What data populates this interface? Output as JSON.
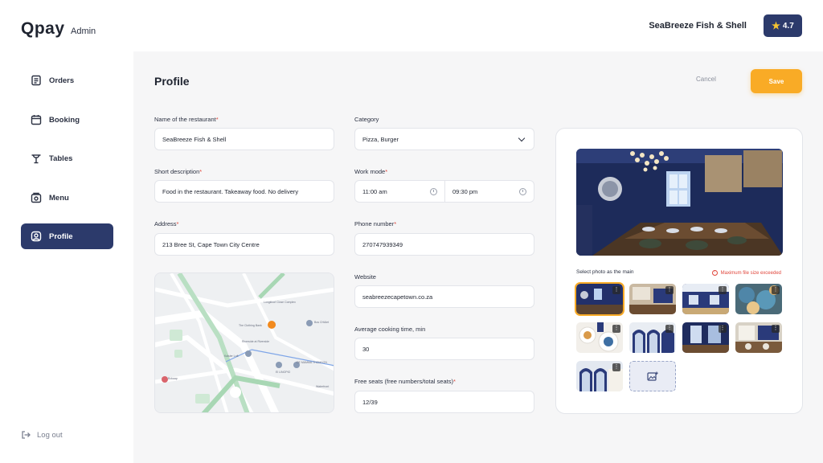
{
  "header": {
    "logo": "Qpay",
    "logo_sub": "Admin",
    "restaurant_name": "SeaBreeze Fish & Shell",
    "rating": "4.7",
    "rating_icon": "star-icon"
  },
  "sidebar": {
    "items": [
      {
        "label": "Orders",
        "icon": "orders-icon",
        "active": false
      },
      {
        "label": "Booking",
        "icon": "calendar-icon",
        "active": false
      },
      {
        "label": "Tables",
        "icon": "table-icon",
        "active": false
      },
      {
        "label": "Menu",
        "icon": "menu-icon",
        "active": false
      },
      {
        "label": "Profile",
        "icon": "user-icon",
        "active": true
      }
    ],
    "logout_label": "Log out"
  },
  "page": {
    "title": "Profile",
    "cancel_label": "Cancel",
    "save_label": "Save"
  },
  "form": {
    "name": {
      "label": "Name of the restaurant",
      "value": "SeaBreeze Fish & Shell"
    },
    "short_description": {
      "label": "Short description",
      "value": "Food in the restaurant. Takeaway food. No delivery"
    },
    "address": {
      "label": "Address",
      "value": "213 Bree St, Cape Town City Centre"
    },
    "category": {
      "label": "Category",
      "value": "Pizza, Burger"
    },
    "work_mode": {
      "label": "Work mode",
      "from": "11:00 am",
      "to": "09:30 pm"
    },
    "phone": {
      "label": "Phone number",
      "value": "270747939349"
    },
    "website": {
      "label": "Website",
      "value": "seabreezecapetown.co.za"
    },
    "cooking_time": {
      "label": "Average cooking time, min",
      "value": "30"
    },
    "free_seats": {
      "label": "Free seats (free numbers/total seats)",
      "value": "12/39"
    }
  },
  "map": {
    "labels": [
      "Longkloof Close Complex",
      "The Clothing Bank",
      "Bos CHAlet",
      "Riverside at Riverside",
      "Kalsler Loft",
      "El LINOPIO",
      "DE MAMMA THOMSON",
      "Bokaap",
      "Waterfront"
    ]
  },
  "photos": {
    "select_label": "Select photo as the main",
    "warning": "Maximum file size exceeded",
    "thumb_count": 9,
    "selected_index": 0
  },
  "colors": {
    "accent": "#f9ab26",
    "nav_active": "#2c3a6b",
    "error": "#e0463b"
  }
}
